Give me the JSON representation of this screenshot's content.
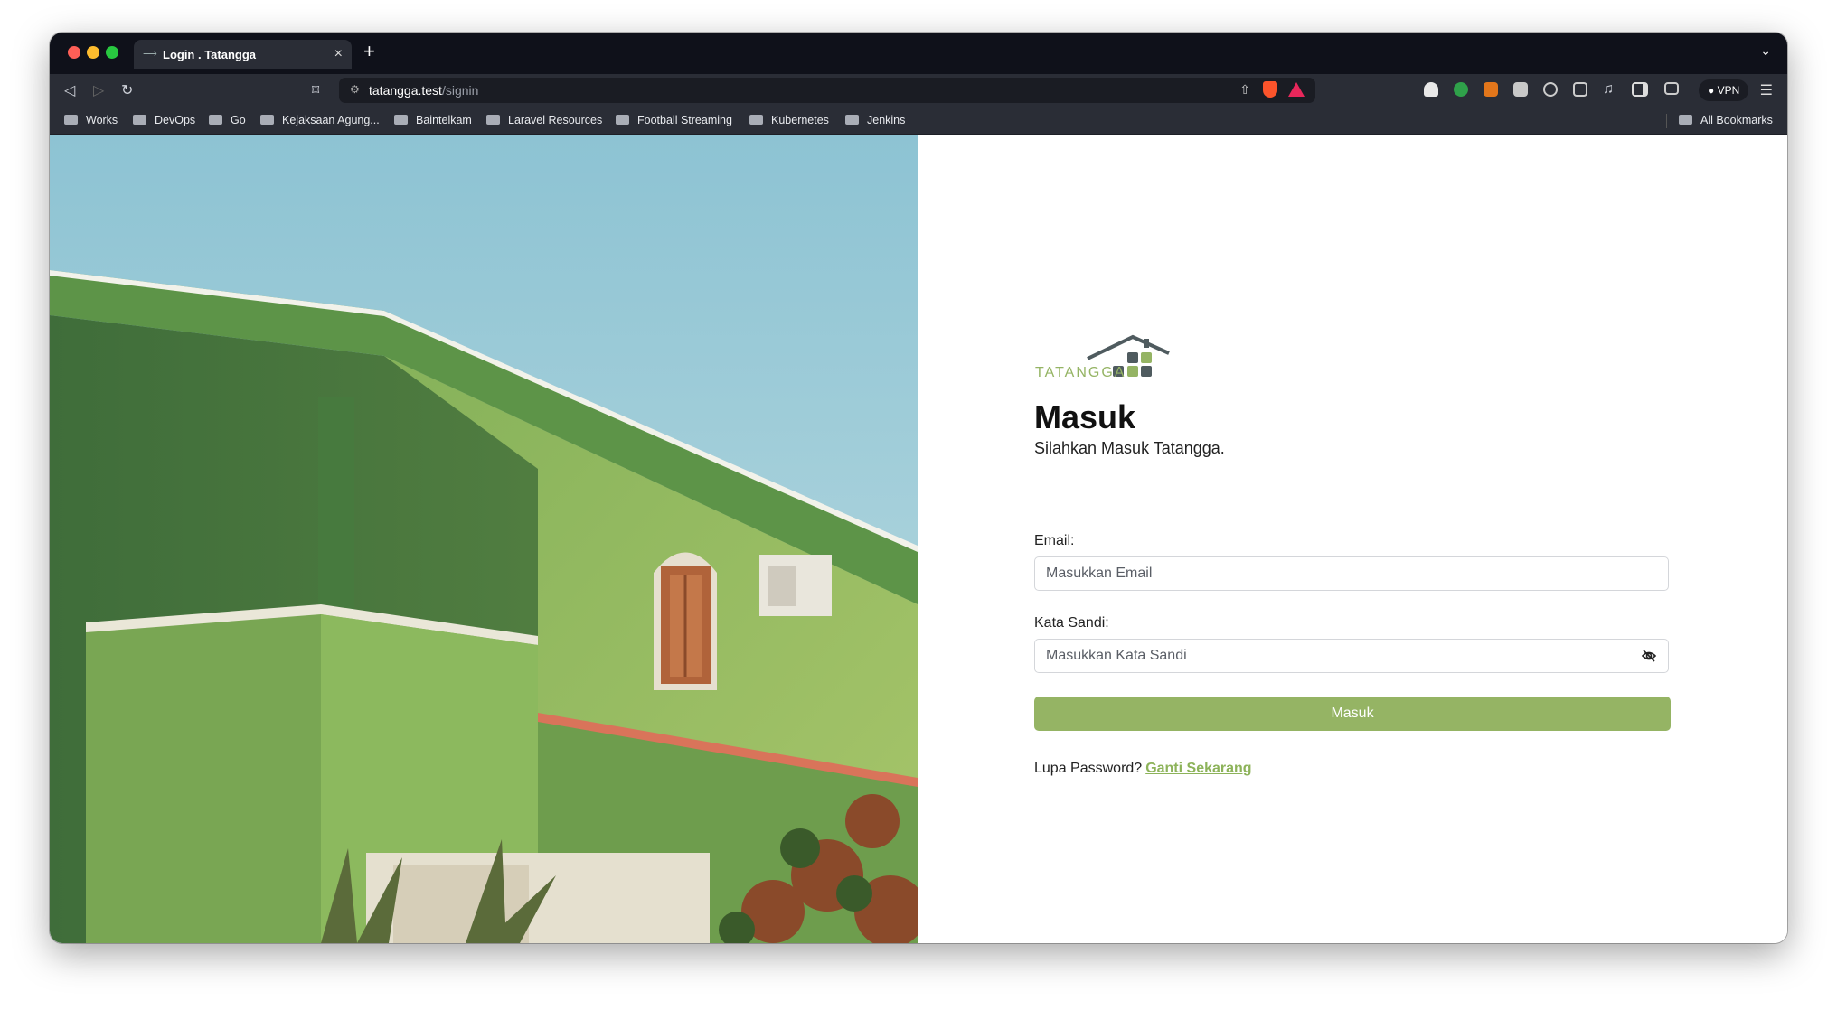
{
  "browser": {
    "tab_title": "Login . Tatangga",
    "url_host": "tatangga.test",
    "url_path": "/signin",
    "vpn_label": "VPN",
    "new_tab_label": "+",
    "close_tab_label": "×"
  },
  "bookmarks": [
    "Works",
    "DevOps",
    "Go",
    "Kejaksaan Agung...",
    "Baintelkam",
    "Laravel Resources",
    "Football Streaming",
    "Kubernetes",
    "Jenkins"
  ],
  "all_bookmarks_label": "All Bookmarks",
  "extensions": [
    "cloud-icon",
    "shield-green-icon",
    "metamask-icon",
    "camera-icon",
    "react-icon",
    "puzzle-icon",
    "music-icon",
    "sidebar-icon",
    "wallet-icon"
  ],
  "logo": {
    "text": "TATANGGA",
    "colors": {
      "green": "#95b464",
      "slate": "#4f5b5f"
    }
  },
  "login": {
    "heading": "Masuk",
    "subheading": "Silahkan Masuk Tatangga.",
    "email_label": "Email:",
    "email_placeholder": "Masukkan Email",
    "password_label": "Kata Sandi:",
    "password_placeholder": "Masukkan Kata Sandi",
    "submit_label": "Masuk",
    "forgot_text": "Lupa Password?",
    "forgot_link": "Ganti Sekarang"
  },
  "colors": {
    "accent": "#95b464",
    "chrome_dark": "#0f111a",
    "chrome": "#2a2d36"
  }
}
